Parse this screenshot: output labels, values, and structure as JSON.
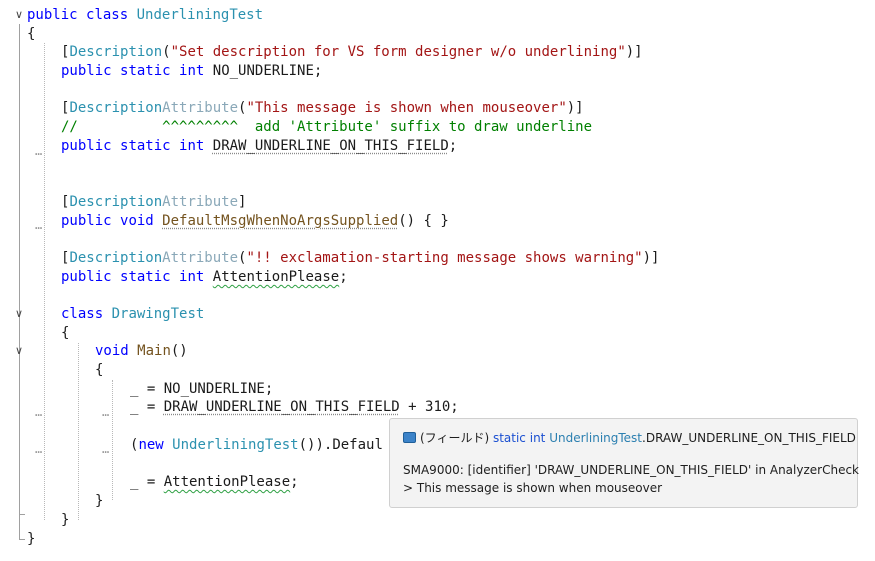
{
  "code": {
    "l1": {
      "kw1": "public",
      "kw2": "class",
      "name": "UnderliningTest"
    },
    "l2": {
      "text": "{"
    },
    "l3": {
      "open": "[",
      "attr": "Description",
      "paren_open": "(",
      "str": "\"Set description for VS form designer w/o underlining\"",
      "close": ")]"
    },
    "l4": {
      "kw1": "public",
      "kw2": "static",
      "kw3": "int",
      "rest": "NO_UNDERLINE;"
    },
    "l6": {
      "open": "[",
      "attr": "Description",
      "attr2": "Attribute",
      "paren_open": "(",
      "str": "\"This message is shown when mouseover\"",
      "close": ")]"
    },
    "l7": {
      "comment": "//          ^^^^^^^^^  add 'Attribute' suffix to draw underline"
    },
    "l8": {
      "kw1": "public",
      "kw2": "static",
      "kw3": "int",
      "field": "DRAW_UNDERLINE_ON_THIS_FIELD",
      "semi": ";"
    },
    "l11": {
      "open": "[",
      "attr": "Description",
      "attr2": "Attribute",
      "close": "]"
    },
    "l12": {
      "kw1": "public",
      "kw2": "void",
      "method": "DefaultMsgWhenNoArgsSupplied",
      "rest": "() { }"
    },
    "l14": {
      "open": "[",
      "attr": "Description",
      "attr2": "Attribute",
      "paren_open": "(",
      "str": "\"!! exclamation-starting message shows warning\"",
      "close": ")]"
    },
    "l15": {
      "kw1": "public",
      "kw2": "static",
      "kw3": "int",
      "field": "AttentionPlease",
      "semi": ";"
    },
    "l17": {
      "kw": "class",
      "name": "DrawingTest"
    },
    "l18": {
      "text": "{"
    },
    "l19": {
      "kw": "void",
      "method": "Main",
      "rest": "()"
    },
    "l20": {
      "text": "{"
    },
    "l21": {
      "text": "_ = NO_UNDERLINE;"
    },
    "l22": {
      "pre": "_ = ",
      "field": "DRAW_UNDERLINE_ON_THIS_FIELD",
      "post": " + 310;"
    },
    "l23": {
      "open": "(",
      "kw": "new",
      "type": "UnderliningTest",
      "mid": "()).",
      "partial": "Defaul"
    },
    "l25": {
      "pre": "_ = ",
      "field": "AttentionPlease",
      "semi": ";"
    },
    "l26": {
      "text": "}"
    },
    "l27": {
      "text": "}"
    },
    "l28": {
      "text": "}"
    }
  },
  "tooltip": {
    "kind": "(フィールド)",
    "kw1": "static",
    "kw2": "int",
    "type": "UnderliningTest",
    "member": ".DRAW_UNDERLINE_ON_THIS_FIELD",
    "line1": "SMA9000: [identifier] 'DRAW_UNDERLINE_ON_THIS_FIELD' in AnalyzerCheck",
    "line2": "> This message is shown when mouseover"
  },
  "fold_glyph": "∨",
  "ellipsis": "…"
}
